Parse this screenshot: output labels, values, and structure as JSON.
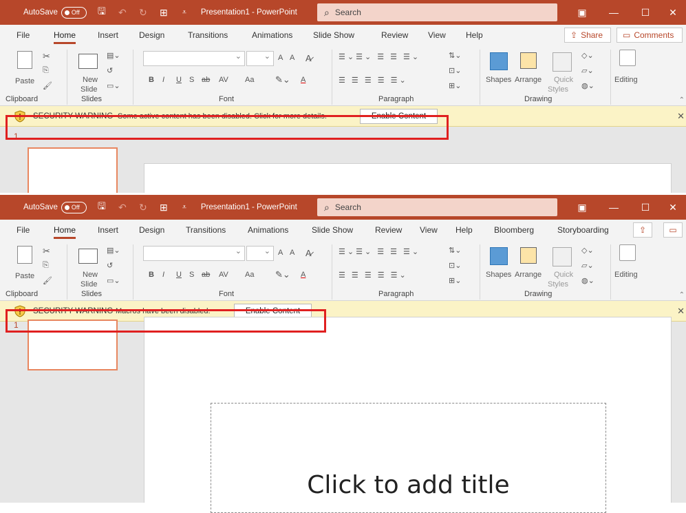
{
  "colors": {
    "accent": "#b7472a",
    "warning_bg": "#fbf3c6",
    "highlight": "#e02020"
  },
  "titlebar": {
    "autosave_label": "AutoSave",
    "toggle_state": "Off",
    "doc_title": "Presentation1  -  PowerPoint",
    "search_placeholder": "Search"
  },
  "pane1": {
    "tabs": [
      "File",
      "Home",
      "Insert",
      "Design",
      "Transitions",
      "Animations",
      "Slide Show",
      "Review",
      "View",
      "Help"
    ],
    "share_label": "Share",
    "comments_label": "Comments",
    "security": {
      "title": "SECURITY WARNING",
      "message": "Some active content has been disabled. Click for more details.",
      "button": "Enable Content"
    },
    "slide_number": "1"
  },
  "pane2": {
    "tabs": [
      "File",
      "Home",
      "Insert",
      "Design",
      "Transitions",
      "Animations",
      "Slide Show",
      "Review",
      "View",
      "Help",
      "Bloomberg",
      "Storyboarding"
    ],
    "security": {
      "title": "SECURITY WARNING",
      "message": "Macros have been disabled.",
      "button": "Enable Content"
    },
    "slide_number": "1",
    "title_placeholder": "Click to add title"
  },
  "ribbon": {
    "paste": "Paste",
    "new_slide_1": "New",
    "new_slide_2": "Slide",
    "shapes": "Shapes",
    "arrange": "Arrange",
    "quick": "Quick",
    "styles": "Styles",
    "editing": "Editing",
    "groups": {
      "clipboard": "Clipboard",
      "slides": "Slides",
      "font": "Font",
      "paragraph": "Paragraph",
      "drawing": "Drawing"
    },
    "font_tools": {
      "bold": "B",
      "italic": "I",
      "underline": "U",
      "shadow": "S",
      "strike": "ab",
      "spacing": "AV",
      "case": "Aa",
      "grow": "A",
      "shrink": "A",
      "color": "A"
    }
  }
}
